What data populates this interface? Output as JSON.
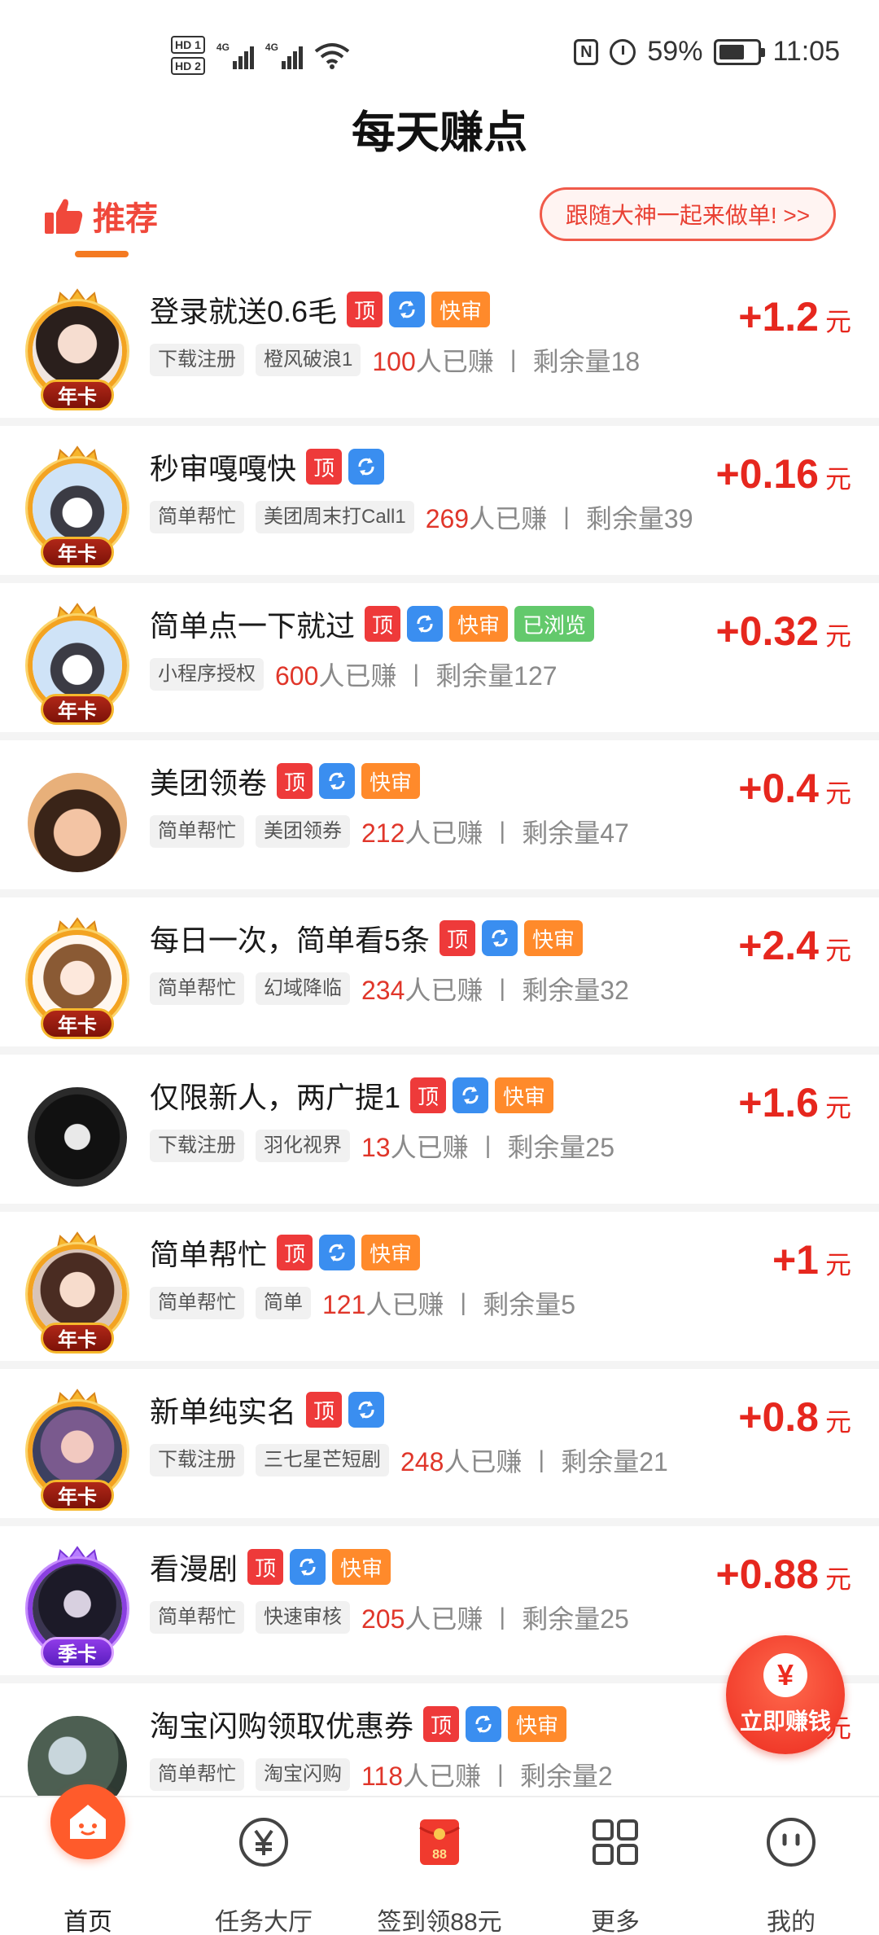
{
  "status_bar": {
    "hd1": "HD 1",
    "hd2": "HD 2",
    "net1": "4G",
    "net2": "4G",
    "nfc": "N",
    "battery": "59%",
    "time": "11:05"
  },
  "page": {
    "title": "每天赚点"
  },
  "tabs": {
    "recommend": "推荐",
    "follow_button": "跟随大神一起来做单! >>"
  },
  "colors": {
    "accent": "#f0483b",
    "reward": "#e6271e",
    "tag_top": "#ee3a3a",
    "tag_refresh": "#3a8ef0",
    "tag_fast": "#ff8a2b",
    "tag_viewed": "#63c96c"
  },
  "tag_labels": {
    "top": "顶",
    "fast": "快审",
    "viewed": "已浏览"
  },
  "tasks": [
    {
      "title": "登录就送0.6毛",
      "chips": [
        "下载注册",
        "橙风破浪1"
      ],
      "earned": "100",
      "earned_suffix": "人已赚",
      "remain": "剩余量18",
      "amount": "+1.2",
      "unit": "元",
      "badge": "年卡",
      "tags": [
        "top",
        "refresh",
        "fast"
      ]
    },
    {
      "title": "秒审嘎嘎快",
      "chips": [
        "简单帮忙",
        "美团周末打Call1"
      ],
      "earned": "269",
      "earned_suffix": "人已赚",
      "remain": "剩余量39",
      "amount": "+0.16",
      "unit": "元",
      "badge": "年卡",
      "tags": [
        "top",
        "refresh"
      ]
    },
    {
      "title": "简单点一下就过",
      "chips": [
        "小程序授权"
      ],
      "earned": "600",
      "earned_suffix": "人已赚",
      "remain": "剩余量127",
      "amount": "+0.32",
      "unit": "元",
      "badge": "年卡",
      "tags": [
        "top",
        "refresh",
        "fast",
        "viewed"
      ]
    },
    {
      "title": "美团领卷",
      "chips": [
        "简单帮忙",
        "美团领券"
      ],
      "earned": "212",
      "earned_suffix": "人已赚",
      "remain": "剩余量47",
      "amount": "+0.4",
      "unit": "元",
      "badge": "",
      "tags": [
        "top",
        "refresh",
        "fast"
      ]
    },
    {
      "title": "每日一次，简单看5条",
      "chips": [
        "简单帮忙",
        "幻域降临"
      ],
      "earned": "234",
      "earned_suffix": "人已赚",
      "remain": "剩余量32",
      "amount": "+2.4",
      "unit": "元",
      "badge": "年卡",
      "tags": [
        "top",
        "refresh",
        "fast"
      ]
    },
    {
      "title": "仅限新人，两广提1",
      "chips": [
        "下载注册",
        "羽化视界"
      ],
      "earned": "13",
      "earned_suffix": "人已赚",
      "remain": "剩余量25",
      "amount": "+1.6",
      "unit": "元",
      "badge": "",
      "tags": [
        "top",
        "refresh",
        "fast"
      ]
    },
    {
      "title": "简单帮忙",
      "chips": [
        "简单帮忙",
        "简单"
      ],
      "earned": "121",
      "earned_suffix": "人已赚",
      "remain": "剩余量5",
      "amount": "+1",
      "unit": "元",
      "badge": "年卡",
      "tags": [
        "top",
        "refresh",
        "fast"
      ]
    },
    {
      "title": "新单纯实名",
      "chips": [
        "下载注册",
        "三七星芒短剧"
      ],
      "earned": "248",
      "earned_suffix": "人已赚",
      "remain": "剩余量21",
      "amount": "+0.8",
      "unit": "元",
      "badge": "年卡",
      "tags": [
        "top",
        "refresh"
      ]
    },
    {
      "title": "看漫剧",
      "chips": [
        "简单帮忙",
        "快速审核"
      ],
      "earned": "205",
      "earned_suffix": "人已赚",
      "remain": "剩余量25",
      "amount": "+0.88",
      "unit": "元",
      "badge": "季卡",
      "tags": [
        "top",
        "refresh",
        "fast"
      ]
    },
    {
      "title": "淘宝闪购领取优惠券",
      "chips": [
        "简单帮忙",
        "淘宝闪购"
      ],
      "earned": "118",
      "earned_suffix": "人已赚",
      "remain": "剩余量2",
      "amount": "",
      "unit": "元",
      "badge": "",
      "tags": [
        "top",
        "refresh",
        "fast"
      ]
    }
  ],
  "float_button": {
    "coin": "¥",
    "label": "立即赚钱"
  },
  "bottom_nav": [
    {
      "label": "首页",
      "icon": "home-icon"
    },
    {
      "label": "任务大厅",
      "icon": "yen-coin-icon"
    },
    {
      "label": "签到领88元",
      "icon": "red-envelope-icon",
      "badge": "88"
    },
    {
      "label": "更多",
      "icon": "grid-icon"
    },
    {
      "label": "我的",
      "icon": "profile-face-icon"
    }
  ]
}
